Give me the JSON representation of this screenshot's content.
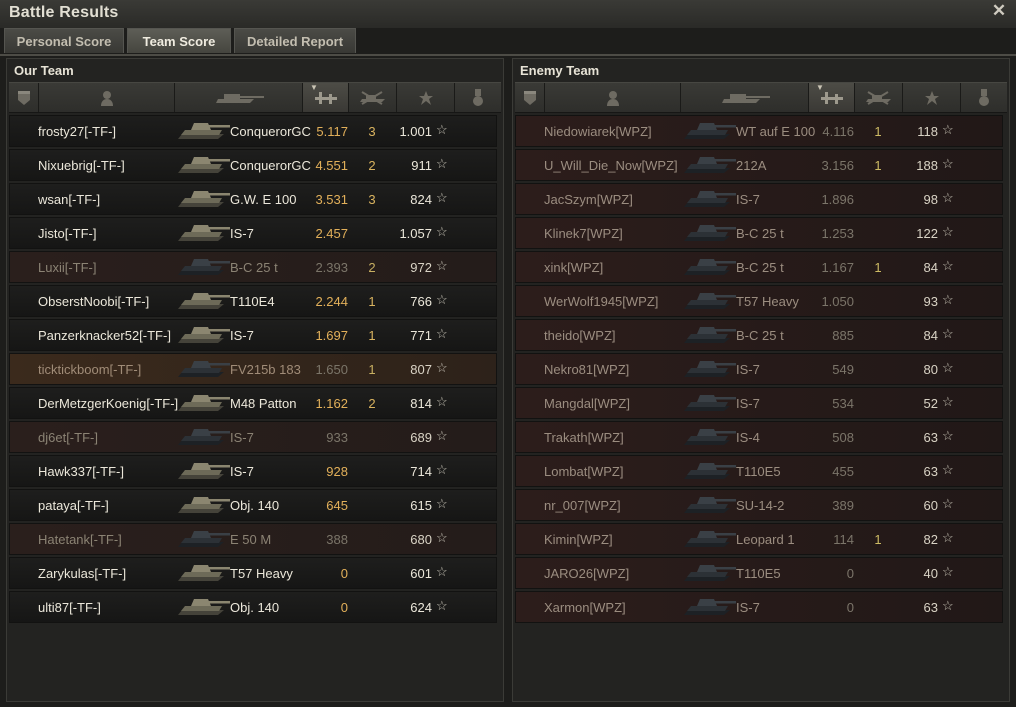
{
  "window": {
    "title": "Battle Results"
  },
  "tabs": [
    "Personal Score",
    "Team Score",
    "Detailed Report"
  ],
  "our_team": {
    "title": "Our Team",
    "rows": [
      {
        "player": "frosty27[-TF-]",
        "tank": "ConquerorGC",
        "xp": "5.117",
        "frags": "3",
        "score": "1.001",
        "state": "alive"
      },
      {
        "player": "Nixuebrig[-TF-]",
        "tank": "ConquerorGC",
        "xp": "4.551",
        "frags": "2",
        "score": "911",
        "state": "alive"
      },
      {
        "player": "wsan[-TF-]",
        "tank": "G.W. E 100",
        "xp": "3.531",
        "frags": "3",
        "score": "824",
        "state": "alive"
      },
      {
        "player": "Jisto[-TF-]",
        "tank": "IS-7",
        "xp": "2.457",
        "frags": "",
        "score": "1.057",
        "state": "alive"
      },
      {
        "player": "Luxii[-TF-]",
        "tank": "B-C 25 t",
        "xp": "2.393",
        "frags": "2",
        "score": "972",
        "state": "dead"
      },
      {
        "player": "ObserstNoobi[-TF-]",
        "tank": "T110E4",
        "xp": "2.244",
        "frags": "1",
        "score": "766",
        "state": "alive"
      },
      {
        "player": "Panzerknacker52[-TF-]",
        "tank": "IS-7",
        "xp": "1.697",
        "frags": "1",
        "score": "771",
        "state": "alive"
      },
      {
        "player": "ticktickboom[-TF-]",
        "tank": "FV215b 183",
        "xp": "1.650",
        "frags": "1",
        "score": "807",
        "state": "highlight"
      },
      {
        "player": "DerMetzgerKoenig[-TF-]",
        "tank": "M48 Patton",
        "xp": "1.162",
        "frags": "2",
        "score": "814",
        "state": "alive"
      },
      {
        "player": "dj6et[-TF-]",
        "tank": "IS-7",
        "xp": "933",
        "frags": "",
        "score": "689",
        "state": "dead"
      },
      {
        "player": "Hawk337[-TF-]",
        "tank": "IS-7",
        "xp": "928",
        "frags": "",
        "score": "714",
        "state": "alive"
      },
      {
        "player": "pataya[-TF-]",
        "tank": "Obj. 140",
        "xp": "645",
        "frags": "",
        "score": "615",
        "state": "alive"
      },
      {
        "player": "Hatetank[-TF-]",
        "tank": "E 50 M",
        "xp": "388",
        "frags": "",
        "score": "680",
        "state": "dead"
      },
      {
        "player": "Zarykulas[-TF-]",
        "tank": "T57 Heavy",
        "xp": "0",
        "frags": "",
        "score": "601",
        "state": "alive"
      },
      {
        "player": "ulti87[-TF-]",
        "tank": "Obj. 140",
        "xp": "0",
        "frags": "",
        "score": "624",
        "state": "alive"
      }
    ]
  },
  "enemy_team": {
    "title": "Enemy Team",
    "rows": [
      {
        "player": "Niedowiarek[WPZ]",
        "tank": "WT auf E 100",
        "xp": "4.116",
        "frags": "1",
        "score": "118",
        "state": "enemy"
      },
      {
        "player": "U_Will_Die_Now[WPZ]",
        "tank": "212A",
        "xp": "3.156",
        "frags": "1",
        "score": "188",
        "state": "enemy"
      },
      {
        "player": "JacSzym[WPZ]",
        "tank": "IS-7",
        "xp": "1.896",
        "frags": "",
        "score": "98",
        "state": "enemy"
      },
      {
        "player": "Klinek7[WPZ]",
        "tank": "B-C 25 t",
        "xp": "1.253",
        "frags": "",
        "score": "122",
        "state": "enemy"
      },
      {
        "player": "xink[WPZ]",
        "tank": "B-C 25 t",
        "xp": "1.167",
        "frags": "1",
        "score": "84",
        "state": "enemy"
      },
      {
        "player": "WerWolf1945[WPZ]",
        "tank": "T57 Heavy",
        "xp": "1.050",
        "frags": "",
        "score": "93",
        "state": "enemy"
      },
      {
        "player": "theido[WPZ]",
        "tank": "B-C 25 t",
        "xp": "885",
        "frags": "",
        "score": "84",
        "state": "enemy"
      },
      {
        "player": "Nekro81[WPZ]",
        "tank": "IS-7",
        "xp": "549",
        "frags": "",
        "score": "80",
        "state": "enemy"
      },
      {
        "player": "Mangdal[WPZ]",
        "tank": "IS-7",
        "xp": "534",
        "frags": "",
        "score": "52",
        "state": "enemy"
      },
      {
        "player": "Trakath[WPZ]",
        "tank": "IS-4",
        "xp": "508",
        "frags": "",
        "score": "63",
        "state": "enemy"
      },
      {
        "player": "Lombat[WPZ]",
        "tank": "T110E5",
        "xp": "455",
        "frags": "",
        "score": "63",
        "state": "enemy"
      },
      {
        "player": "nr_007[WPZ]",
        "tank": "SU-14-2",
        "xp": "389",
        "frags": "",
        "score": "60",
        "state": "enemy"
      },
      {
        "player": "Kimin[WPZ]",
        "tank": "Leopard 1",
        "xp": "114",
        "frags": "1",
        "score": "82",
        "state": "enemy"
      },
      {
        "player": "JARO26[WPZ]",
        "tank": "T110E5",
        "xp": "0",
        "frags": "",
        "score": "40",
        "state": "enemy"
      },
      {
        "player": "Xarmon[WPZ]",
        "tank": "IS-7",
        "xp": "0",
        "frags": "",
        "score": "63",
        "state": "enemy"
      }
    ]
  },
  "colors": {
    "xp_gold": "#e2b05a",
    "frags_yellow": "#d9b35f",
    "bg": "#1d1d1b"
  },
  "icons": [
    "close-icon",
    "rank-icon",
    "player-icon",
    "tank-icon",
    "xp-icon",
    "frags-icon",
    "star-icon",
    "medal-icon"
  ]
}
